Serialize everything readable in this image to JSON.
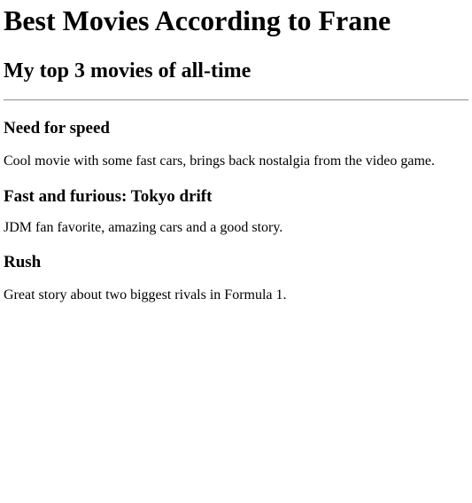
{
  "page": {
    "title": "Best Movies According to Frane",
    "subtitle": "My top 3 movies of all-time"
  },
  "movies": [
    {
      "title": "Need for speed",
      "description": "Cool movie with some fast cars, brings back nostalgia from the video game."
    },
    {
      "title": "Fast and furious: Tokyo drift",
      "description": "JDM fan favorite, amazing cars and a good story."
    },
    {
      "title": "Rush",
      "description": "Great story about two biggest rivals in Formula 1."
    }
  ]
}
